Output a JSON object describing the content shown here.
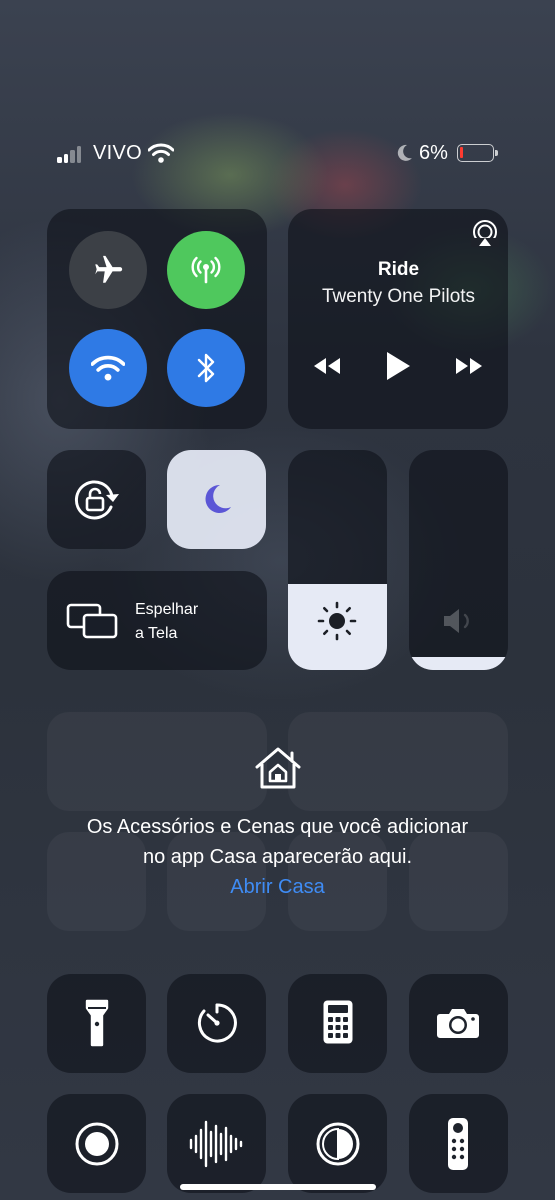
{
  "status_bar": {
    "carrier": "VIVO",
    "battery_percent": "6%",
    "battery_level": 0.06,
    "icons": [
      "cellular-signal-icon",
      "wifi-icon",
      "do-not-disturb-moon-icon",
      "battery-icon"
    ]
  },
  "connectivity": {
    "airplane_mode": {
      "icon": "airplane-icon",
      "on": false
    },
    "cellular_data": {
      "icon": "antenna-icon",
      "on": true,
      "color": "#4fc85d"
    },
    "wifi": {
      "icon": "wifi-icon",
      "on": true,
      "color": "#2f7ae5"
    },
    "bluetooth": {
      "icon": "bluetooth-icon",
      "on": true,
      "color": "#2f7ae5"
    }
  },
  "now_playing": {
    "title": "Ride",
    "artist": "Twenty One Pilots",
    "icons": [
      "airplay-icon",
      "rewind-icon",
      "play-icon",
      "fast-forward-icon"
    ]
  },
  "toggles": {
    "orientation_lock": {
      "icon": "orientation-lock-icon",
      "on": false
    },
    "do_not_disturb": {
      "icon": "moon-icon",
      "on": true,
      "color": "#5b56d6"
    }
  },
  "screen_mirroring": {
    "label_line1": "Espelhar",
    "label_line2": "a Tela",
    "icon": "screen-mirroring-icon"
  },
  "sliders": {
    "brightness": {
      "icon": "sun-icon",
      "level": 0.39
    },
    "volume": {
      "icon": "speaker-icon",
      "level": 0.06
    }
  },
  "home": {
    "message_line1": "Os Acessórios e Cenas que você adicionar",
    "message_line2": "no app Casa aparecerão aqui.",
    "link": "Abrir Casa",
    "link_color": "#3f8cf5",
    "icon": "home-icon"
  },
  "bottom_controls": [
    {
      "icon": "flashlight-icon"
    },
    {
      "icon": "timer-icon"
    },
    {
      "icon": "calculator-icon"
    },
    {
      "icon": "camera-icon"
    },
    {
      "icon": "screen-recording-icon"
    },
    {
      "icon": "voice-memos-icon"
    },
    {
      "icon": "dark-mode-icon"
    },
    {
      "icon": "apple-tv-remote-icon"
    }
  ]
}
